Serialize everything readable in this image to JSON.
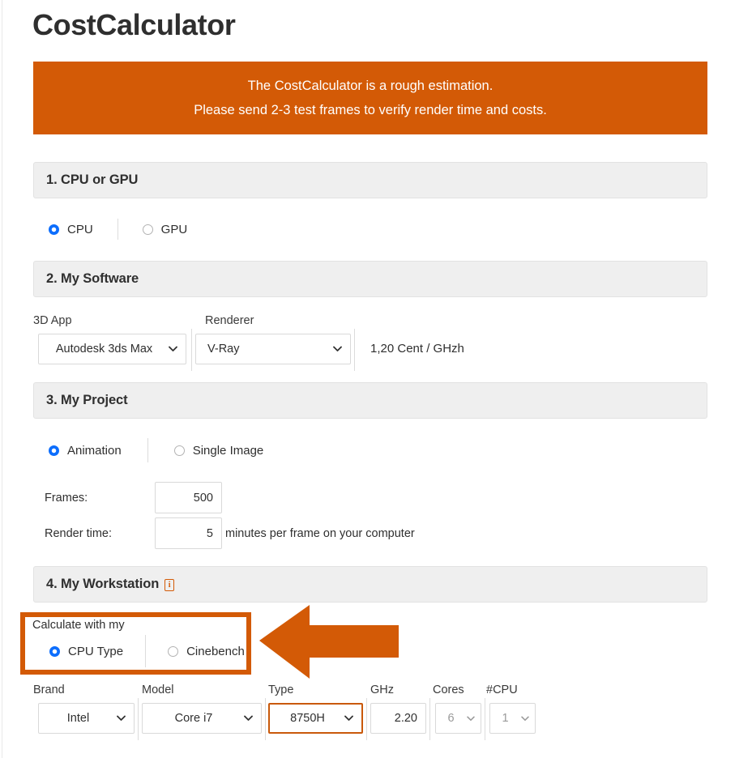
{
  "page": {
    "title": "CostCalculator"
  },
  "banner": {
    "line1": "The CostCalculator is a rough estimation.",
    "line2": "Please send 2-3 test frames to verify render time and costs."
  },
  "sections": {
    "cpu_or_gpu": {
      "header": "1. CPU or GPU",
      "options": [
        {
          "label": "CPU",
          "selected": true
        },
        {
          "label": "GPU",
          "selected": false
        }
      ]
    },
    "my_software": {
      "header": "2. My Software",
      "app_label": "3D App",
      "app_value": "Autodesk 3ds Max",
      "renderer_label": "Renderer",
      "renderer_value": "V-Ray",
      "price_note": "1,20 Cent / GHzh"
    },
    "my_project": {
      "header": "3. My Project",
      "options": [
        {
          "label": "Animation",
          "selected": true
        },
        {
          "label": "Single Image",
          "selected": false
        }
      ],
      "frames_label": "Frames:",
      "frames_value": "500",
      "render_time_label": "Render time:",
      "render_time_value": "5",
      "render_time_suffix": "minutes per frame on your computer"
    },
    "my_workstation": {
      "header": "4. My Workstation",
      "info_icon_glyph": "i",
      "calculate_with_label": "Calculate with my",
      "options": [
        {
          "label": "CPU Type",
          "selected": true
        },
        {
          "label": "Cinebench",
          "selected": false
        }
      ],
      "fields": [
        {
          "label": "Brand",
          "value": "Intel",
          "type": "select",
          "disabled": false,
          "highlighted": false
        },
        {
          "label": "Model",
          "value": "Core i7",
          "type": "select",
          "disabled": false,
          "highlighted": false
        },
        {
          "label": "Type",
          "value": "8750H",
          "type": "select",
          "disabled": false,
          "highlighted": true
        },
        {
          "label": "GHz",
          "value": "2.20",
          "type": "text",
          "disabled": false,
          "highlighted": false
        },
        {
          "label": "Cores",
          "value": "6",
          "type": "select",
          "disabled": true,
          "highlighted": false
        },
        {
          "label": "#CPU",
          "value": "1",
          "type": "select",
          "disabled": true,
          "highlighted": false
        }
      ]
    }
  },
  "colors": {
    "brand_orange": "#d35a06",
    "accent_border": "#c9590b",
    "radio_blue": "#0d6efd",
    "header_gray": "#efefef"
  }
}
